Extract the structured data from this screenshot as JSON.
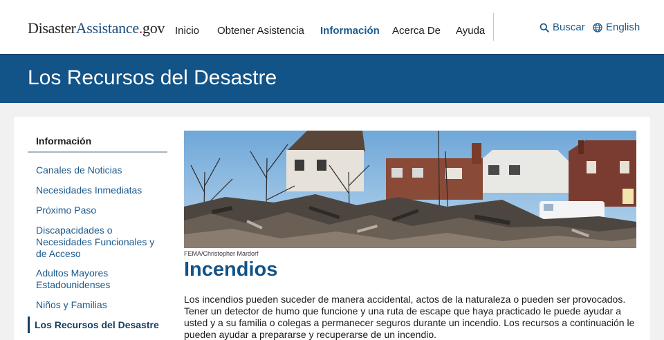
{
  "header": {
    "logo": {
      "part1": "Disaster",
      "part2": "Assistance",
      "part3": ".",
      "part4": "gov"
    },
    "nav": [
      {
        "label": "Inicio",
        "active": false
      },
      {
        "label": "Obtener Asistencia",
        "active": false
      },
      {
        "label": "Información",
        "active": true
      },
      {
        "label": "Acerca De",
        "active": false
      },
      {
        "label": "Ayuda",
        "active": false
      }
    ],
    "search": {
      "label": "Buscar",
      "icon": "search-icon"
    },
    "language": {
      "label": "English",
      "icon": "globe-icon"
    }
  },
  "banner": {
    "title": "Los Recursos del Desastre"
  },
  "sidebar": {
    "heading": "Información",
    "items": [
      {
        "label": "Canales de Noticias"
      },
      {
        "label": "Necesidades Inmediatas"
      },
      {
        "label": "Próximo Paso"
      },
      {
        "label": "Discapacidades o Necesidades Funcionales y de Acceso"
      },
      {
        "label": "Adultos Mayores Estadounidenses"
      },
      {
        "label": "Niños y Familias"
      },
      {
        "label": "Los Recursos del Desastre",
        "current": true
      }
    ]
  },
  "main": {
    "image_caption": "FEMA/Christopher Mardorf",
    "title": "Incendios",
    "body": "Los incendios pueden suceder de manera accidental, actos de la naturaleza o pueden ser provocados. Tener un detector de humo que funcione y una ruta de escape que haya practicado le puede ayudar a usted y a su familia o colegas a permanecer seguros durante un incendio. Los recursos a continuación le pueden ayudar a prepararse y recuperarse de un incendio."
  },
  "colors": {
    "brand_blue": "#125388",
    "link_blue": "#1c5a8c",
    "logo_dot_red": "#c41230"
  }
}
